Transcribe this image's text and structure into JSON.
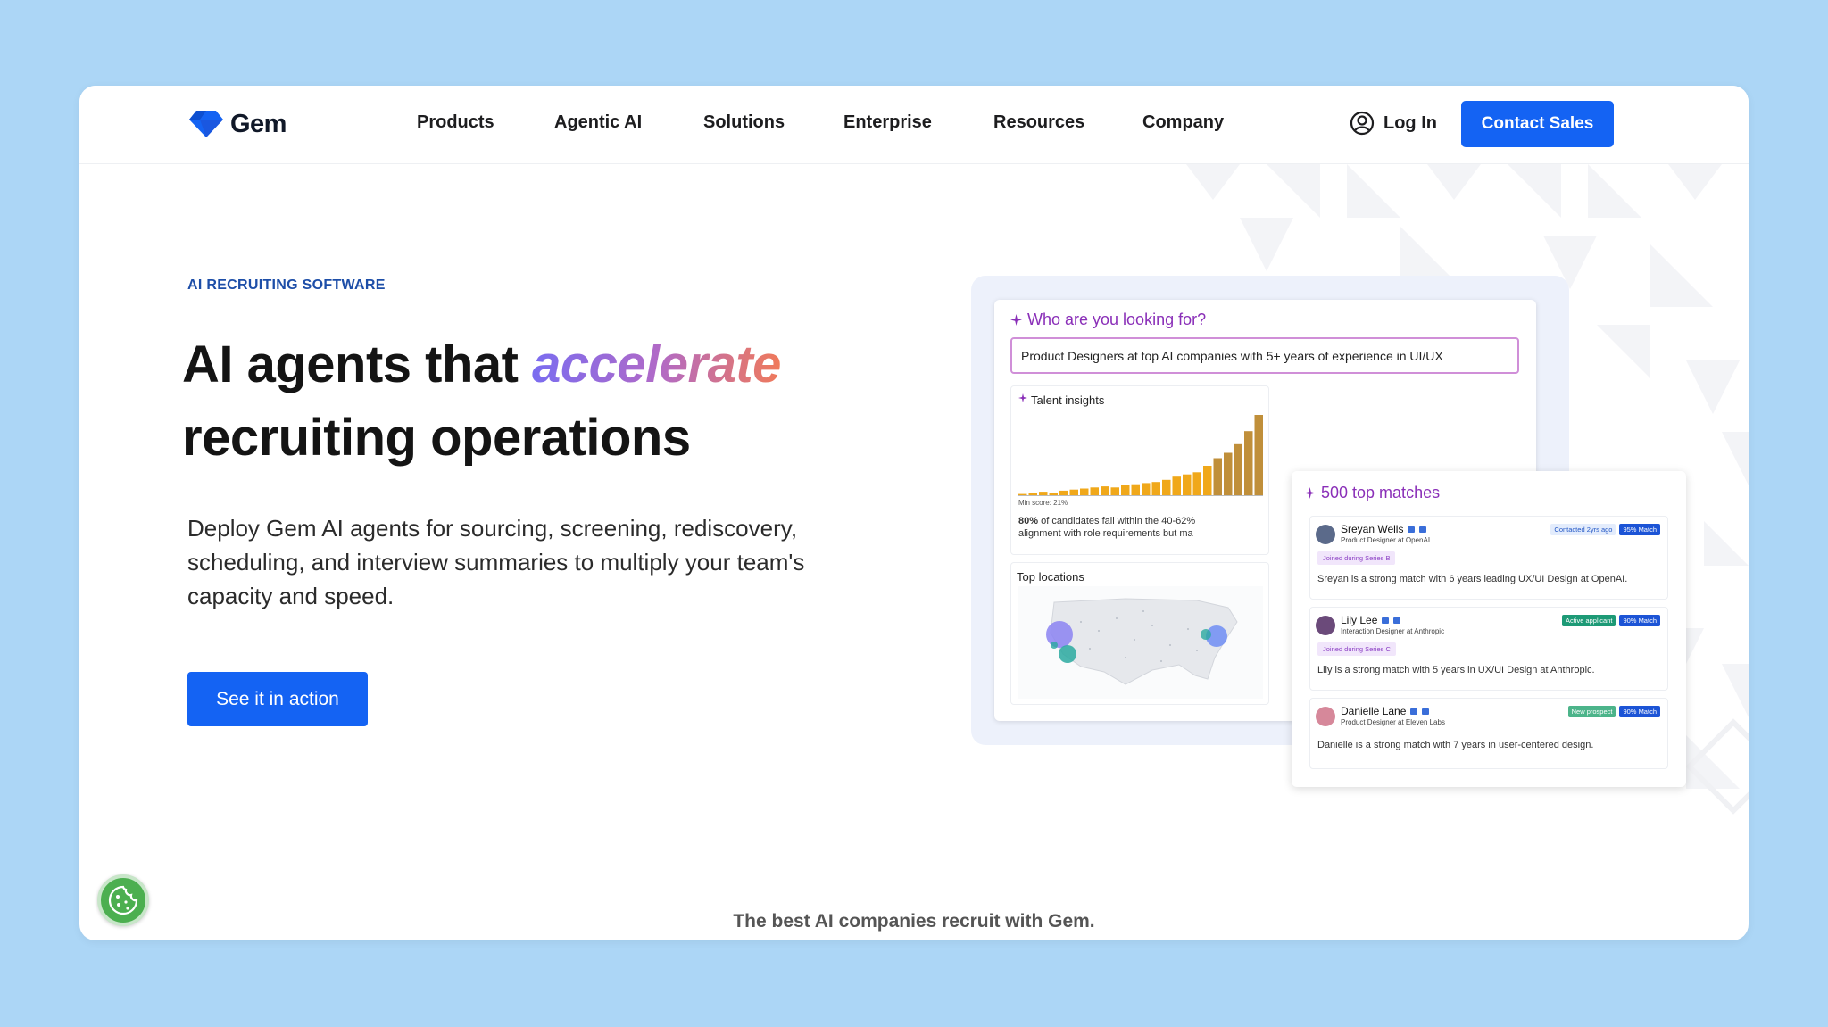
{
  "brand": {
    "name": "Gem",
    "color": "#1463f3"
  },
  "nav": {
    "items": [
      "Products",
      "Agentic AI",
      "Solutions",
      "Enterprise",
      "Resources",
      "Company"
    ],
    "login": "Log In",
    "cta": "Contact Sales"
  },
  "hero": {
    "eyebrow": "AI RECRUITING SOFTWARE",
    "headline_pre": "AI agents that ",
    "headline_accent": "accelerate",
    "headline_post": "recruiting operations",
    "description": "Deploy Gem AI agents for sourcing, screening, rediscovery, scheduling, and interview summaries to multiply your team's capacity and speed.",
    "button": "See it in action"
  },
  "tagline": "The best AI companies recruit with Gem.",
  "mock": {
    "search": {
      "title": "Who are you looking for?",
      "query": "Product Designers at top AI companies with 5+ years of experience in UI/UX"
    },
    "talent_insights": {
      "title": "Talent insights",
      "min_score": "Min score: 21%",
      "note_bold": "80%",
      "note": " of candidates fall within the 40-62% alignment with role requirements but ma",
      "bars": [
        2,
        3,
        4,
        3,
        5,
        6,
        7,
        8,
        9,
        8,
        10,
        11,
        12,
        13,
        15,
        18,
        20,
        22,
        28,
        35,
        40,
        48,
        60,
        75
      ]
    },
    "top_locations": {
      "title": "Top locations"
    },
    "matches": {
      "title": "500 top matches",
      "items": [
        {
          "name": "Sreyan Wells",
          "role": "Product Designer at OpenAI",
          "status": "Contacted 2yrs ago",
          "match": "95% Match",
          "tag": "Joined during Series B",
          "summary": "Sreyan is a strong match with 6 years leading UX/UI Design at OpenAI."
        },
        {
          "name": "Lily Lee",
          "role": "Interaction Designer at Anthropic",
          "status": "Active applicant",
          "match": "90% Match",
          "tag": "Joined during Series C",
          "summary": "Lily is a strong match with 5 years in UX/UI Design at Anthropic."
        },
        {
          "name": "Danielle Lane",
          "role": "Product Designer at Eleven Labs",
          "status": "New prospect",
          "match": "90% Match",
          "tag": "",
          "summary": "Danielle is a strong match with 7 years in user-centered design."
        }
      ]
    }
  },
  "icons": {
    "logo": "gem-diamond-icon",
    "login": "user-circle-icon",
    "sparkle": "sparkle-icon",
    "cookie": "cookie-icon"
  }
}
